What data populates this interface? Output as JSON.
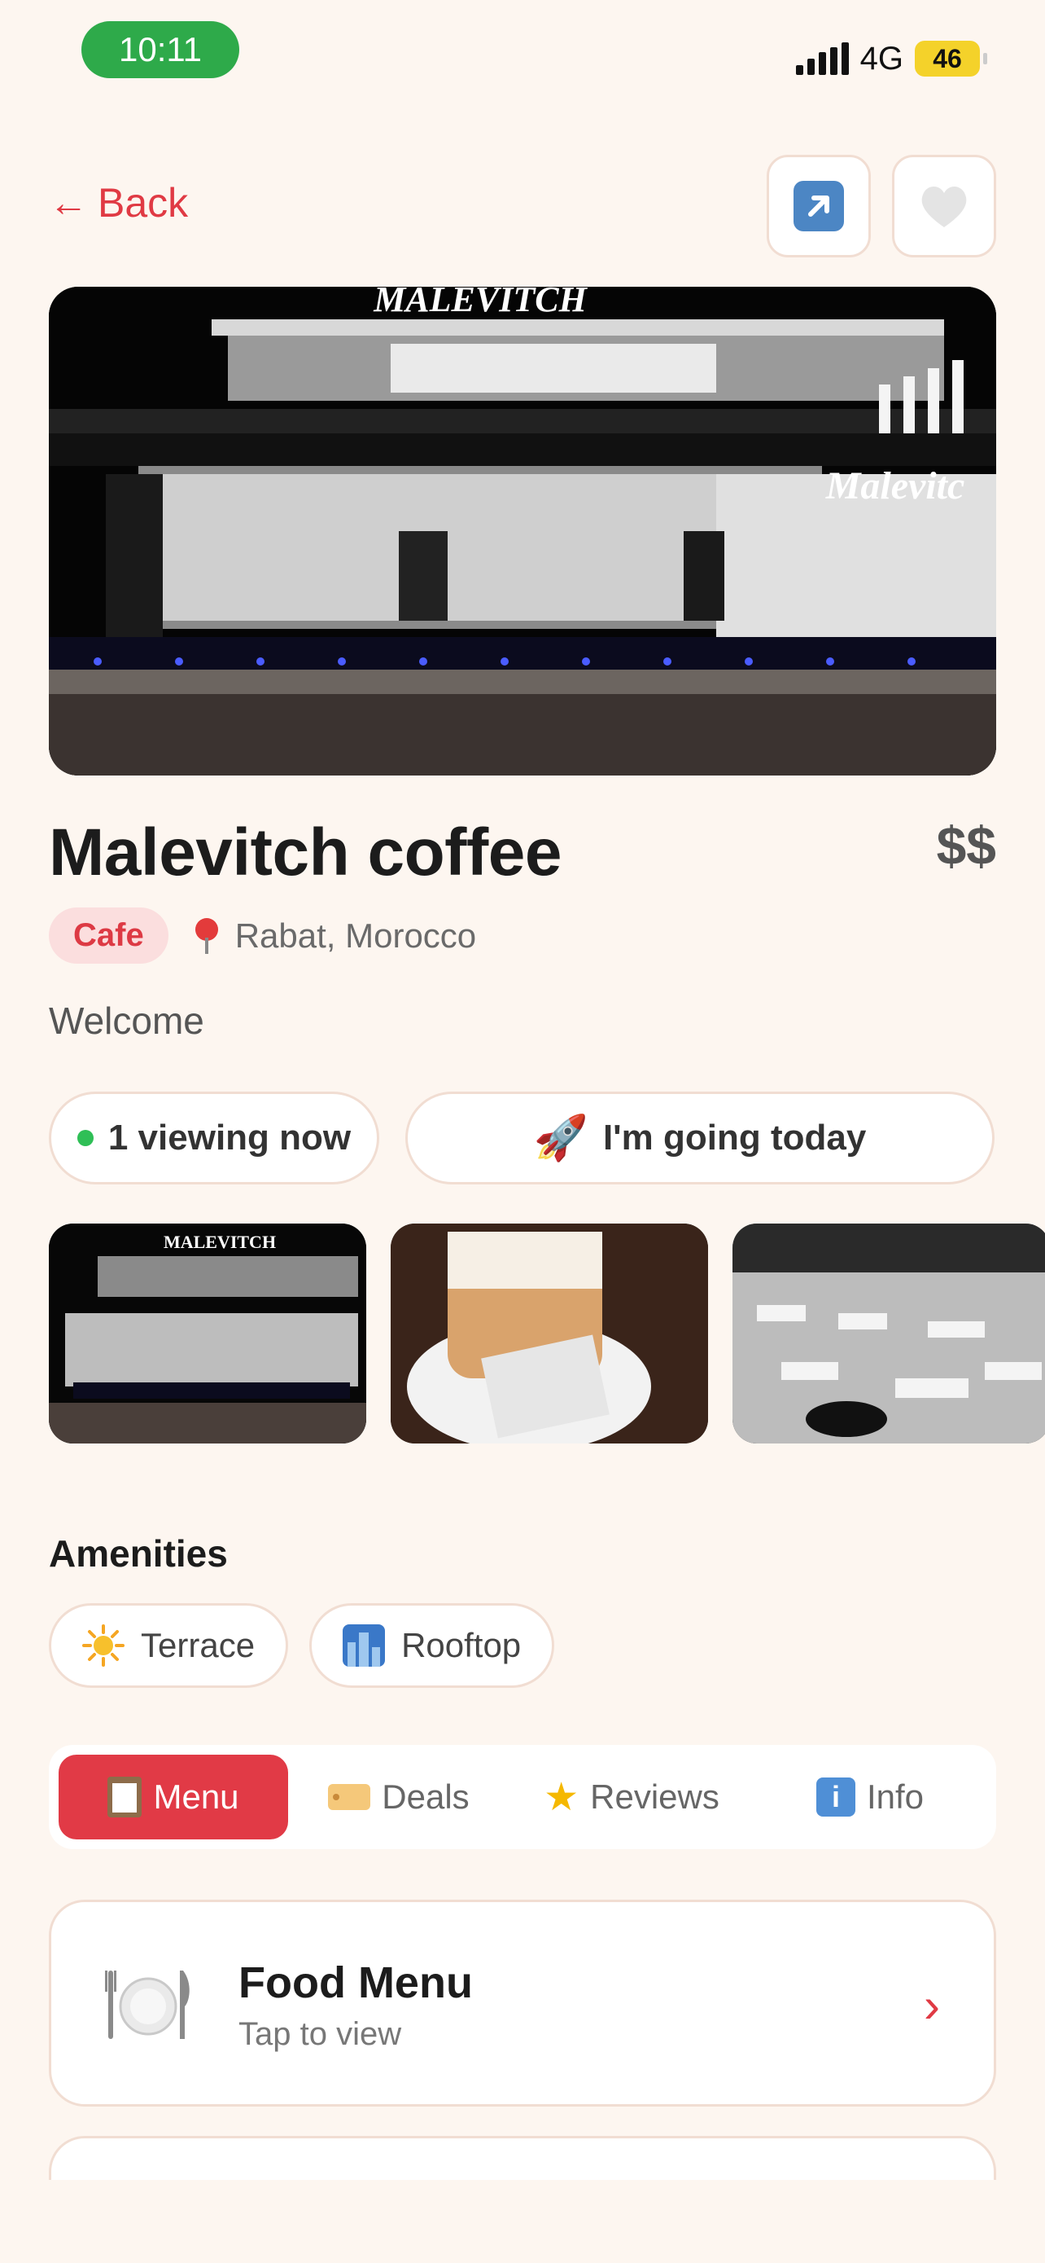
{
  "status_bar": {
    "time": "10:11",
    "network": "4G",
    "battery": "46"
  },
  "nav": {
    "back_label": "Back",
    "share_icon": "share-arrow-icon",
    "favorite_icon": "heart-icon"
  },
  "place": {
    "name": "Malevitch coffee",
    "price": "$$",
    "category": "Cafe",
    "location": "Rabat, Morocco",
    "description": "Welcome",
    "hero_sign": "MALEVITCH",
    "hero_sign_side": "Malevitc"
  },
  "actions": {
    "viewing_label": "1 viewing now",
    "going_emoji": "🚀",
    "going_label": "I'm going today"
  },
  "gallery": [
    {
      "name": "storefront-night"
    },
    {
      "name": "coffee-latte"
    },
    {
      "name": "interior-seating"
    }
  ],
  "gallery_sign": "MALEVITCH",
  "amenities": {
    "title": "Amenities",
    "items": [
      {
        "icon": "sun-icon",
        "label": "Terrace"
      },
      {
        "icon": "city-icon",
        "label": "Rooftop"
      }
    ]
  },
  "tabs": [
    {
      "icon": "clipboard-icon",
      "label": "Menu",
      "active": true
    },
    {
      "icon": "tag-icon",
      "label": "Deals",
      "active": false
    },
    {
      "icon": "star-icon",
      "label": "Reviews",
      "active": false
    },
    {
      "icon": "info-icon",
      "label": "Info",
      "active": false
    }
  ],
  "menu_card": {
    "icon": "plate-fork-knife-icon",
    "title": "Food Menu",
    "subtitle": "Tap to view"
  },
  "colors": {
    "accent": "#e13a46",
    "background": "#fdf6f0",
    "status_green": "#2eaa4a"
  }
}
